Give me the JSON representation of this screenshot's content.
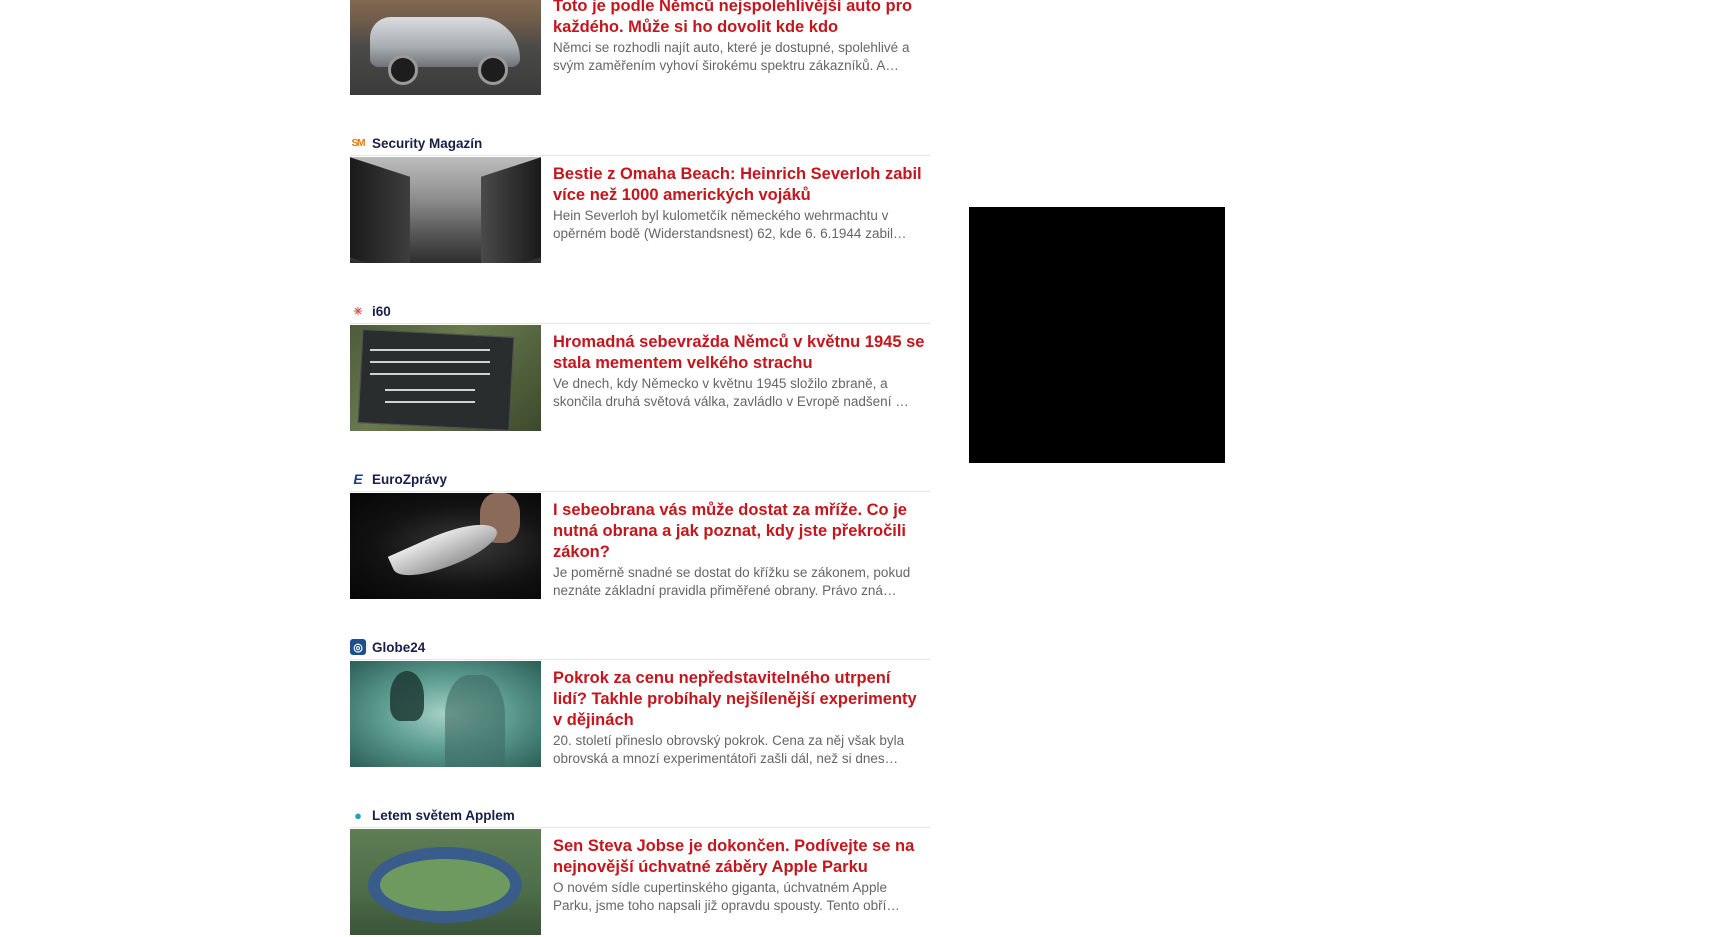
{
  "articles": [
    {
      "source": "",
      "logo_text": "",
      "logo_color": "#ffffff",
      "thumb": "car",
      "title": "Toto je podle Němců nejspolehlivější auto pro každého. Může si ho dovolit kde kdo",
      "perex": "Němci se rozhodli najít auto, které je dostupné, spolehlivé a svým zaměřením vyhoví širokému spektru zákazníků. A…"
    },
    {
      "source": "Security Magazín",
      "logo_text": "SM",
      "logo_color": "#e8760a",
      "thumb": "beach",
      "title": "Bestie z Omaha Beach: Heinrich Severloh zabil více než 1000 amerických vojáků",
      "perex": "Hein Severloh byl kulometčík německého wehrmachtu v opěrném bodě (Widerstandsnest) 62, kde 6. 6.1944 zabil…"
    },
    {
      "source": "i60",
      "logo_text": "✳",
      "logo_color": "#d9534f",
      "thumb": "plaque",
      "title": "Hromadná sebevražda Němců v květnu 1945 se stala mementem velkého strachu",
      "perex": "Ve dnech, kdy Německo v květnu 1945 složilo zbraně, a skončila druhá světová válka, zavládlo v Evropě nadšení …"
    },
    {
      "source": "EuroZprávy",
      "logo_text": "E",
      "logo_color": "#1f3a8a",
      "thumb": "knife",
      "title": "I sebeobrana vás může dostat za mříže. Co je nutná obrana a jak poznat, kdy jste překročili zákon?",
      "perex": "Je poměrně snadné se dostat do křížku se zákonem, pokud neznáte základní pravidla přiměřené obrany. Právo zná…"
    },
    {
      "source": "Globe24",
      "logo_text": "◎",
      "logo_color": "#1f4e8a",
      "thumb": "ghost",
      "title": "Pokrok za cenu nepředstavitelného utrpení lidí? Takhle probíhaly nejšílenější experimenty v dějinách",
      "perex": "20. století přineslo obrovský pokrok. Cena za něj však byla obrovská a mnozí experimentátoři zašli dál, než si dnes…"
    },
    {
      "source": "Letem světem Applem",
      "logo_text": "●",
      "logo_color": "#1ea3c7",
      "thumb": "park",
      "title": "Sen Steva Jobse je dokončen. Podívejte se na nejnovější úchvatné záběry Apple Parku",
      "perex": "O novém sídle cupertinského giganta, úchvatném Apple Parku, jsme toho napsali již opravdu spousty. Tento obří…"
    }
  ]
}
